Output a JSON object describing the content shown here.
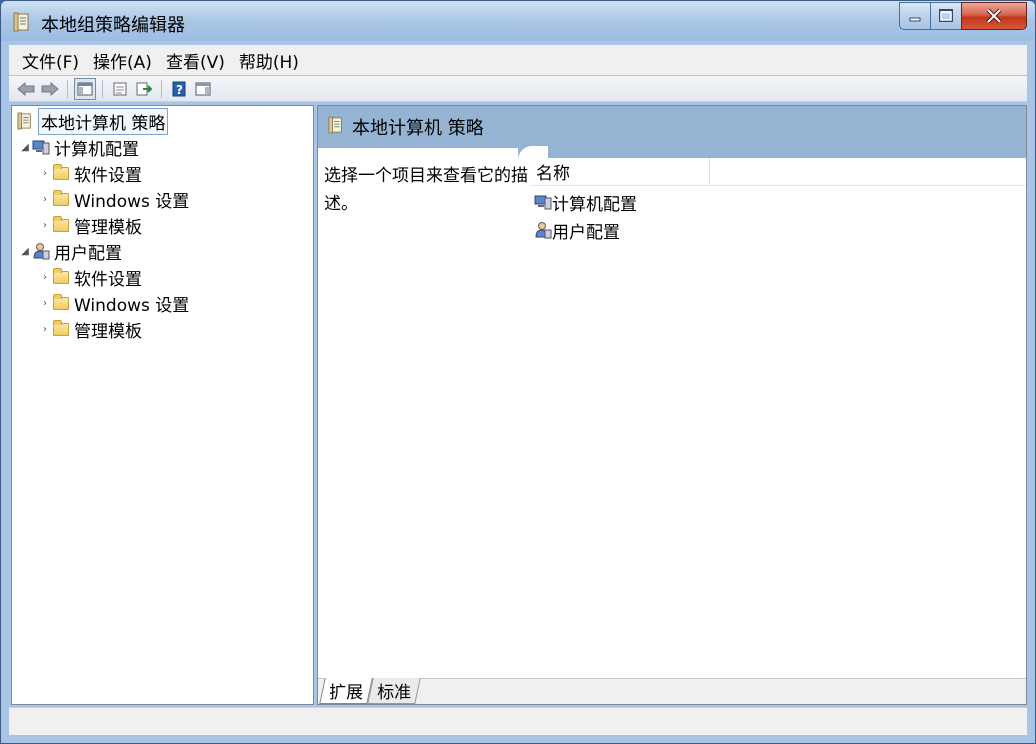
{
  "window": {
    "title": "本地组策略编辑器"
  },
  "menu": [
    "文件(F)",
    "操作(A)",
    "查看(V)",
    "帮助(H)"
  ],
  "toolbar": {
    "icons": [
      "back-icon",
      "forward-icon",
      "show-hide-tree-icon",
      "properties-icon",
      "export-list-icon",
      "help-icon",
      "show-hide-action-pane-icon"
    ]
  },
  "tree": {
    "root": "本地计算机 策略",
    "computer_config": {
      "label": "计算机配置",
      "children": [
        "软件设置",
        "Windows 设置",
        "管理模板"
      ]
    },
    "user_config": {
      "label": "用户配置",
      "children": [
        "软件设置",
        "Windows 设置",
        "管理模板"
      ]
    }
  },
  "details": {
    "header_title": "本地计算机 策略",
    "description": "选择一个项目来查看它的描述。",
    "column_name": "名称",
    "items": [
      "计算机配置",
      "用户配置"
    ]
  },
  "tabs": [
    "扩展",
    "标准"
  ],
  "colors": {
    "header_band": "#95b4d3",
    "titlebar": "#aac6e6",
    "close_button": "#c3361c"
  }
}
